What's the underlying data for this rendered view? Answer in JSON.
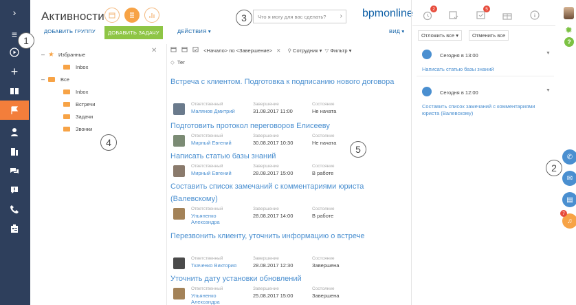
{
  "app": {
    "title": "Активности",
    "search_placeholder": "Что я могу для вас сделать?",
    "logo": "bpmonline"
  },
  "toolbar": {
    "add_group": "ДОБАВИТЬ ГРУППУ",
    "add_task": "ДОБАВИТЬ ЗАДАЧУ",
    "actions": "ДЕЙСТВИЯ ▾",
    "view": "ВИД ▾"
  },
  "callouts": [
    "1",
    "2",
    "3",
    "4",
    "5"
  ],
  "folders": {
    "favorites": "Избранные",
    "fav_inbox": "Inbox",
    "all": "Все",
    "inbox": "Inbox",
    "meetings": "Встречи",
    "tasks": "Задачи",
    "calls": "Звонки"
  },
  "filters": {
    "period": "<Начало> по <Завершение>",
    "employee": "Сотрудник ▾",
    "filter": "Фильтр ▾",
    "tag": "Тег"
  },
  "labels": {
    "responsible": "Ответственный",
    "end": "Завершение",
    "state": "Состояние"
  },
  "activities": [
    {
      "title": "Встреча с клиентом. Подготовка к подписанию нового договора",
      "person": "Малянов Дмитрий",
      "end": "31.08.2017 11:00",
      "state": "Не начата"
    },
    {
      "title": "Подготовить протокол переговоров Елисееву",
      "person": "Мирный Евгений",
      "end": "30.08.2017 10:30",
      "state": "Не начата"
    },
    {
      "title": "Написать статью базы знаний",
      "person": "Мирный Евгений",
      "end": "28.08.2017 15:00",
      "state": "В работе"
    },
    {
      "title": "Составить список замечаний с комментариями юриста (Валевскому)",
      "person": "Ульяненко Александра",
      "end": "28.08.2017 14:00",
      "state": "В работе"
    },
    {
      "title": "Перезвонить клиенту, уточнить информацию о встрече",
      "person": "Ткаченко Виктория",
      "end": "28.08.2017 12:30",
      "state": "Завершена"
    },
    {
      "title": "Уточнить дату установки обновлений",
      "person": "Ульяненко Александра",
      "end": "25.08.2017 15:00",
      "state": "Завершена"
    }
  ],
  "notifications": {
    "badges": [
      "2",
      "5",
      "7"
    ],
    "postpone_all": "Отложить все ▾",
    "cancel_all": "Отменить все",
    "items": [
      {
        "time": "Сегодня в 13:00",
        "text": "Написать статью базы знаний"
      },
      {
        "time": "Сегодня в 12:00",
        "text": "Составить список замечаний с комментариями юриста (Валевскому)"
      }
    ]
  },
  "colors": {
    "sidebar": "#2e3f5c",
    "active": "#f37e3b",
    "accent": "#f7a346",
    "link": "#4a8fd0",
    "success": "#8ec545"
  }
}
